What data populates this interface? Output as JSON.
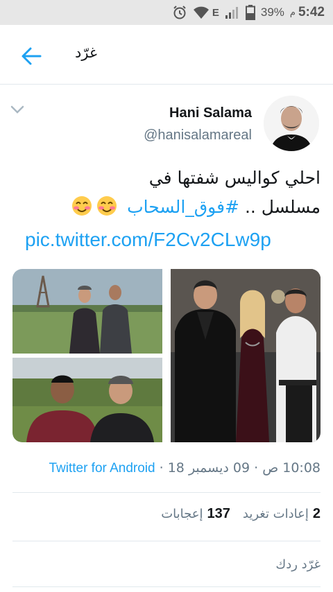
{
  "status_bar": {
    "time": "5:42",
    "ampm": "م",
    "battery": "39%",
    "network": "E",
    "icons": [
      "alarm-icon",
      "wifi-icon",
      "signal-icon",
      "battery-icon"
    ]
  },
  "header": {
    "back_icon": "arrow-left-icon",
    "title": "غرّد"
  },
  "tweet": {
    "user_name": "Hani Salama",
    "handle": "@hanisalamareal",
    "text_line1": "احلي كواليس شفتها في",
    "text_line2_prefix": "مسلسل .. ",
    "hashtag": "#فوق_السحاب",
    "emoji": [
      "smiling-face-icon",
      "smiling-face-icon"
    ],
    "link": "pic.twitter.com/F2Cv2CLw9p",
    "time": "10:08 ص",
    "date": "09 ديسمبر 18",
    "separator": "·",
    "source": "Twitter for Android",
    "retweet_count": "2",
    "retweet_label": "إعادات تغريد",
    "like_count": "137",
    "like_label": "إعجابات",
    "reply_placeholder": "غرّد ردك"
  },
  "colors": {
    "accent": "#1da1f2",
    "secondary_text": "#657786",
    "divider": "#e1e8ed"
  }
}
